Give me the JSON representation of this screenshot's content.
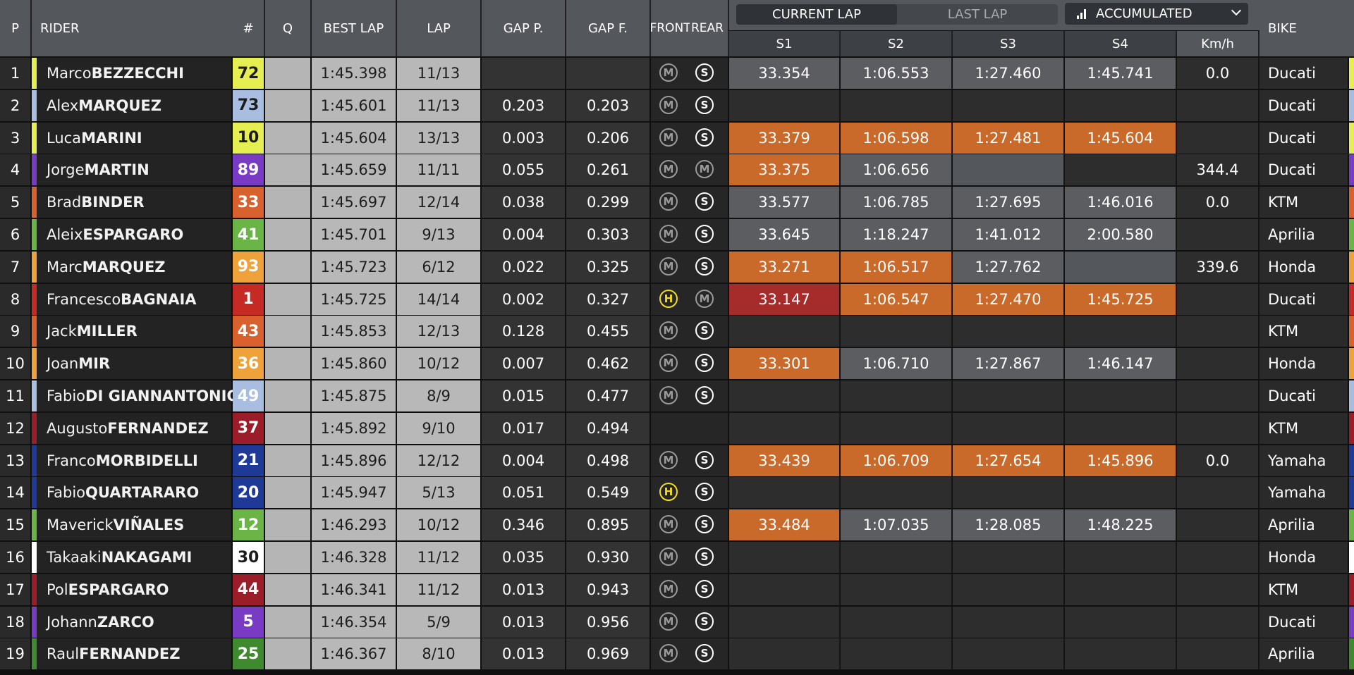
{
  "colors": {
    "header_bg": "#54575c",
    "sector_personal_best": "#c9692a",
    "sector_overall_best": "#a62b2b",
    "sector_normal": "#5b5d61",
    "sector_empty": "#2d2d2d",
    "sector_pending": "#54575c"
  },
  "header": {
    "pos": "P",
    "rider": "RIDER",
    "num": "#",
    "q": "Q",
    "best_lap": "BEST LAP",
    "lap": "LAP",
    "gap_p": "GAP P.",
    "gap_f": "GAP F.",
    "front": "FRONT",
    "rear": "REAR",
    "bike": "BIKE",
    "tabs": {
      "current": "CURRENT LAP",
      "last": "LAST LAP",
      "accumulated": "ACCUMULATED"
    },
    "sectors": [
      "S1",
      "S2",
      "S3",
      "S4"
    ],
    "speed": "Km/h"
  },
  "riders": [
    {
      "pos": "1",
      "first": "Marco",
      "last": "BEZZECCHI",
      "num": "72",
      "num_bg": "#e6ef52",
      "num_fg": "#1d1d1d",
      "stripe": "#e6ef52",
      "best": "1:45.398",
      "lap": "11/13",
      "gap_p": "",
      "gap_f": "",
      "front": "M",
      "rear": "S",
      "sectors": [
        [
          "33.354",
          "normal"
        ],
        [
          "1:06.553",
          "normal"
        ],
        [
          "1:27.460",
          "normal"
        ],
        [
          "1:45.741",
          "normal"
        ]
      ],
      "kmh": "0.0",
      "bike": "Ducati"
    },
    {
      "pos": "2",
      "first": "Alex",
      "last": "MARQUEZ",
      "num": "73",
      "num_bg": "#a9bde0",
      "num_fg": "#1d1d1d",
      "stripe": "#a9bde0",
      "best": "1:45.601",
      "lap": "11/13",
      "gap_p": "0.203",
      "gap_f": "0.203",
      "front": "M",
      "rear": "S",
      "sectors": [
        [
          "",
          "empty"
        ],
        [
          "",
          "empty"
        ],
        [
          "",
          "empty"
        ],
        [
          "",
          "empty"
        ]
      ],
      "kmh": "",
      "bike": "Ducati"
    },
    {
      "pos": "3",
      "first": "Luca",
      "last": "MARINI",
      "num": "10",
      "num_bg": "#e6ef52",
      "num_fg": "#1d1d1d",
      "stripe": "#e6ef52",
      "best": "1:45.604",
      "lap": "13/13",
      "gap_p": "0.003",
      "gap_f": "0.206",
      "front": "M",
      "rear": "S",
      "sectors": [
        [
          "33.379",
          "pb"
        ],
        [
          "1:06.598",
          "pb"
        ],
        [
          "1:27.481",
          "pb"
        ],
        [
          "1:45.604",
          "pb"
        ]
      ],
      "kmh": "",
      "bike": "Ducati"
    },
    {
      "pos": "4",
      "first": "Jorge",
      "last": "MARTIN",
      "num": "89",
      "num_bg": "#7a3bc4",
      "num_fg": "#ffffff",
      "stripe": "#7a3bc4",
      "best": "1:45.659",
      "lap": "11/11",
      "gap_p": "0.055",
      "gap_f": "0.261",
      "front": "M",
      "rear": "M",
      "sectors": [
        [
          "33.375",
          "pb"
        ],
        [
          "1:06.656",
          "normal"
        ],
        [
          "",
          "pending"
        ],
        [
          "",
          "empty"
        ]
      ],
      "kmh": "344.4",
      "bike": "Ducati"
    },
    {
      "pos": "5",
      "first": "Brad",
      "last": "BINDER",
      "num": "33",
      "num_bg": "#d9612e",
      "num_fg": "#ffffff",
      "stripe": "#d9612e",
      "best": "1:45.697",
      "lap": "12/14",
      "gap_p": "0.038",
      "gap_f": "0.299",
      "front": "M",
      "rear": "S",
      "sectors": [
        [
          "33.577",
          "normal"
        ],
        [
          "1:06.785",
          "normal"
        ],
        [
          "1:27.695",
          "normal"
        ],
        [
          "1:46.016",
          "normal"
        ]
      ],
      "kmh": "0.0",
      "bike": "KTM"
    },
    {
      "pos": "6",
      "first": "Aleix",
      "last": "ESPARGARO",
      "num": "41",
      "num_bg": "#6ab546",
      "num_fg": "#ffffff",
      "stripe": "#6ab546",
      "best": "1:45.701",
      "lap": "9/13",
      "gap_p": "0.004",
      "gap_f": "0.303",
      "front": "M",
      "rear": "S",
      "sectors": [
        [
          "33.645",
          "normal"
        ],
        [
          "1:18.247",
          "normal"
        ],
        [
          "1:41.012",
          "normal"
        ],
        [
          "2:00.580",
          "normal"
        ]
      ],
      "kmh": "",
      "bike": "Aprilia"
    },
    {
      "pos": "7",
      "first": "Marc",
      "last": "MARQUEZ",
      "num": "93",
      "num_bg": "#f0a23a",
      "num_fg": "#ffffff",
      "stripe": "#f0a23a",
      "best": "1:45.723",
      "lap": "6/12",
      "gap_p": "0.022",
      "gap_f": "0.325",
      "front": "M",
      "rear": "S",
      "sectors": [
        [
          "33.271",
          "pb"
        ],
        [
          "1:06.517",
          "pb"
        ],
        [
          "1:27.762",
          "normal"
        ],
        [
          "",
          "pending"
        ]
      ],
      "kmh": "339.6",
      "bike": "Honda"
    },
    {
      "pos": "8",
      "first": "Francesco",
      "last": "BAGNAIA",
      "num": "1",
      "num_bg": "#c52a25",
      "num_fg": "#ffffff",
      "stripe": "#c52a25",
      "best": "1:45.725",
      "lap": "14/14",
      "gap_p": "0.002",
      "gap_f": "0.327",
      "front": "H",
      "rear": "M",
      "sectors": [
        [
          "33.147",
          "ob"
        ],
        [
          "1:06.547",
          "pb"
        ],
        [
          "1:27.470",
          "pb"
        ],
        [
          "1:45.725",
          "pb"
        ]
      ],
      "kmh": "",
      "bike": "Ducati"
    },
    {
      "pos": "9",
      "first": "Jack",
      "last": "MILLER",
      "num": "43",
      "num_bg": "#d9612e",
      "num_fg": "#ffffff",
      "stripe": "#d9612e",
      "best": "1:45.853",
      "lap": "12/13",
      "gap_p": "0.128",
      "gap_f": "0.455",
      "front": "M",
      "rear": "S",
      "sectors": [
        [
          "",
          "empty"
        ],
        [
          "",
          "empty"
        ],
        [
          "",
          "empty"
        ],
        [
          "",
          "empty"
        ]
      ],
      "kmh": "",
      "bike": "KTM"
    },
    {
      "pos": "10",
      "first": "Joan",
      "last": "MIR",
      "num": "36",
      "num_bg": "#f0a23a",
      "num_fg": "#ffffff",
      "stripe": "#f0a23a",
      "best": "1:45.860",
      "lap": "10/12",
      "gap_p": "0.007",
      "gap_f": "0.462",
      "front": "M",
      "rear": "S",
      "sectors": [
        [
          "33.301",
          "pb"
        ],
        [
          "1:06.710",
          "normal"
        ],
        [
          "1:27.867",
          "normal"
        ],
        [
          "1:46.147",
          "normal"
        ]
      ],
      "kmh": "",
      "bike": "Honda"
    },
    {
      "pos": "11",
      "first": "Fabio",
      "last": "DI GIANNANTONIO",
      "num": "49",
      "num_bg": "#a9bde0",
      "num_fg": "#ffffff",
      "stripe": "#a9bde0",
      "best": "1:45.875",
      "lap": "8/9",
      "gap_p": "0.015",
      "gap_f": "0.477",
      "front": "M",
      "rear": "S",
      "sectors": [
        [
          "",
          "empty"
        ],
        [
          "",
          "empty"
        ],
        [
          "",
          "empty"
        ],
        [
          "",
          "empty"
        ]
      ],
      "kmh": "",
      "bike": "Ducati"
    },
    {
      "pos": "12",
      "first": "Augusto",
      "last": "FERNANDEZ",
      "num": "37",
      "num_bg": "#9b1d2a",
      "num_fg": "#ffffff",
      "stripe": "#9b1d2a",
      "best": "1:45.892",
      "lap": "9/10",
      "gap_p": "0.017",
      "gap_f": "0.494",
      "front": "",
      "rear": "",
      "sectors": [
        [
          "",
          "empty"
        ],
        [
          "",
          "empty"
        ],
        [
          "",
          "empty"
        ],
        [
          "",
          "empty"
        ]
      ],
      "kmh": "",
      "bike": "KTM"
    },
    {
      "pos": "13",
      "first": "Franco",
      "last": "MORBIDELLI",
      "num": "21",
      "num_bg": "#1e3a96",
      "num_fg": "#ffffff",
      "stripe": "#1e3a96",
      "best": "1:45.896",
      "lap": "12/12",
      "gap_p": "0.004",
      "gap_f": "0.498",
      "front": "M",
      "rear": "S",
      "sectors": [
        [
          "33.439",
          "pb"
        ],
        [
          "1:06.709",
          "pb"
        ],
        [
          "1:27.654",
          "pb"
        ],
        [
          "1:45.896",
          "pb"
        ]
      ],
      "kmh": "0.0",
      "bike": "Yamaha"
    },
    {
      "pos": "14",
      "first": "Fabio",
      "last": "QUARTARARO",
      "num": "20",
      "num_bg": "#1e3a96",
      "num_fg": "#ffffff",
      "stripe": "#1e3a96",
      "best": "1:45.947",
      "lap": "5/13",
      "gap_p": "0.051",
      "gap_f": "0.549",
      "front": "H",
      "rear": "S",
      "sectors": [
        [
          "",
          "empty"
        ],
        [
          "",
          "empty"
        ],
        [
          "",
          "empty"
        ],
        [
          "",
          "empty"
        ]
      ],
      "kmh": "",
      "bike": "Yamaha"
    },
    {
      "pos": "15",
      "first": "Maverick",
      "last": "VIÑALES",
      "num": "12",
      "num_bg": "#6ab546",
      "num_fg": "#ffffff",
      "stripe": "#6ab546",
      "best": "1:46.293",
      "lap": "10/12",
      "gap_p": "0.346",
      "gap_f": "0.895",
      "front": "M",
      "rear": "S",
      "sectors": [
        [
          "33.484",
          "pb"
        ],
        [
          "1:07.035",
          "normal"
        ],
        [
          "1:28.085",
          "normal"
        ],
        [
          "1:48.225",
          "normal"
        ]
      ],
      "kmh": "",
      "bike": "Aprilia"
    },
    {
      "pos": "16",
      "first": "Takaaki",
      "last": "NAKAGAMI",
      "num": "30",
      "num_bg": "#ffffff",
      "num_fg": "#1d1d1d",
      "stripe": "#ffffff",
      "best": "1:46.328",
      "lap": "11/12",
      "gap_p": "0.035",
      "gap_f": "0.930",
      "front": "M",
      "rear": "S",
      "sectors": [
        [
          "",
          "empty"
        ],
        [
          "",
          "empty"
        ],
        [
          "",
          "empty"
        ],
        [
          "",
          "empty"
        ]
      ],
      "kmh": "",
      "bike": "Honda"
    },
    {
      "pos": "17",
      "first": "Pol",
      "last": "ESPARGARO",
      "num": "44",
      "num_bg": "#9b1d2a",
      "num_fg": "#ffffff",
      "stripe": "#9b1d2a",
      "best": "1:46.341",
      "lap": "11/12",
      "gap_p": "0.013",
      "gap_f": "0.943",
      "front": "M",
      "rear": "S",
      "sectors": [
        [
          "",
          "empty"
        ],
        [
          "",
          "empty"
        ],
        [
          "",
          "empty"
        ],
        [
          "",
          "empty"
        ]
      ],
      "kmh": "",
      "bike": "KTM"
    },
    {
      "pos": "18",
      "first": "Johann",
      "last": "ZARCO",
      "num": "5",
      "num_bg": "#7a3bc4",
      "num_fg": "#ffffff",
      "stripe": "#7a3bc4",
      "best": "1:46.354",
      "lap": "5/9",
      "gap_p": "0.013",
      "gap_f": "0.956",
      "front": "M",
      "rear": "S",
      "sectors": [
        [
          "",
          "empty"
        ],
        [
          "",
          "empty"
        ],
        [
          "",
          "empty"
        ],
        [
          "",
          "empty"
        ]
      ],
      "kmh": "",
      "bike": "Ducati"
    },
    {
      "pos": "19",
      "first": "Raul",
      "last": "FERNANDEZ",
      "num": "25",
      "num_bg": "#3f8a2e",
      "num_fg": "#ffffff",
      "stripe": "#3f8a2e",
      "best": "1:46.367",
      "lap": "8/10",
      "gap_p": "0.013",
      "gap_f": "0.969",
      "front": "M",
      "rear": "S",
      "sectors": [
        [
          "",
          "empty"
        ],
        [
          "",
          "empty"
        ],
        [
          "",
          "empty"
        ],
        [
          "",
          "empty"
        ]
      ],
      "kmh": "",
      "bike": "Aprilia"
    }
  ]
}
